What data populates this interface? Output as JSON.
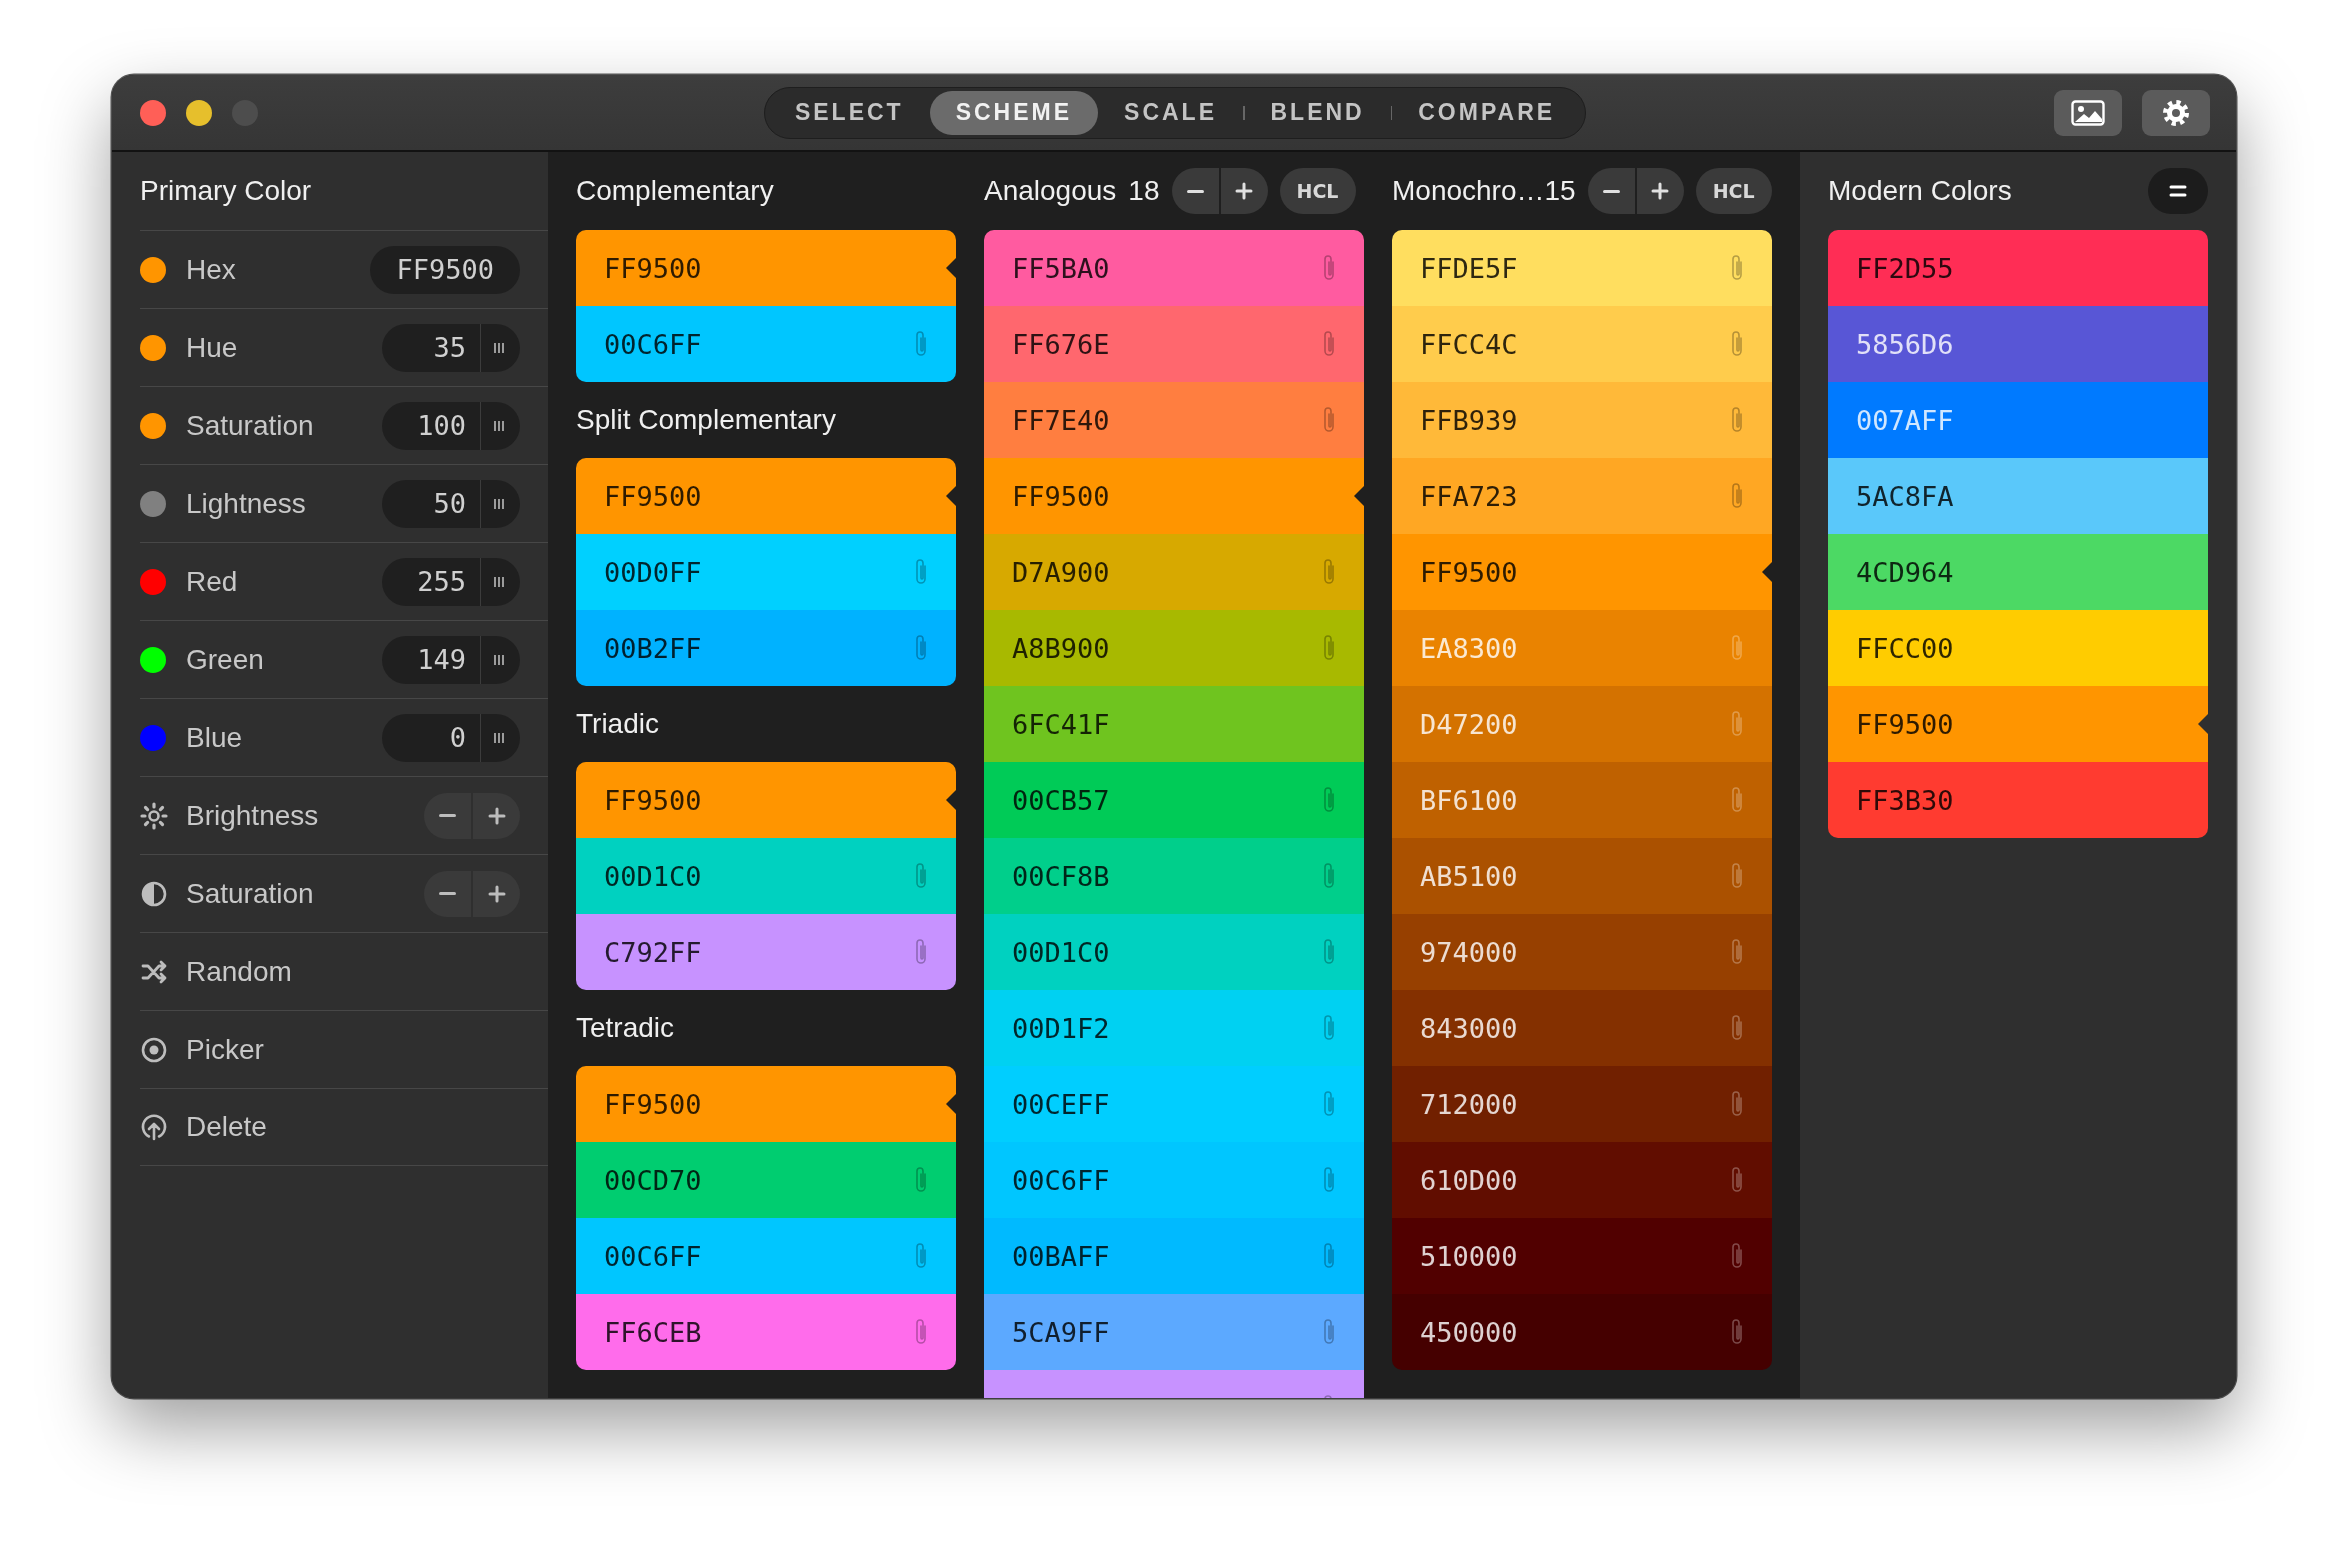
{
  "title_bar": {
    "traffic_lights": [
      {
        "color": "#ff5f57"
      },
      {
        "color": "#e6bf2c"
      },
      {
        "color": "#4d4d4d"
      }
    ],
    "tabs": [
      {
        "label": "SELECT",
        "selected": false
      },
      {
        "label": "SCHEME",
        "selected": true
      },
      {
        "label": "SCALE",
        "selected": false
      },
      {
        "label": "BLEND",
        "selected": false
      },
      {
        "label": "COMPARE",
        "selected": false
      }
    ]
  },
  "sidebar": {
    "title": "Primary Color",
    "rows": [
      {
        "kind": "hex",
        "label": "Hex",
        "color": "#ff9500",
        "value": "FF9500"
      },
      {
        "kind": "value",
        "label": "Hue",
        "color": "#ff9500",
        "value": "35"
      },
      {
        "kind": "value",
        "label": "Saturation",
        "color": "#ff9500",
        "value": "100"
      },
      {
        "kind": "value",
        "label": "Lightness",
        "color": "#808080",
        "value": "50"
      },
      {
        "kind": "value",
        "label": "Red",
        "color": "#ff0000",
        "value": "255"
      },
      {
        "kind": "value",
        "label": "Green",
        "color": "#00ff00",
        "value": "149"
      },
      {
        "kind": "value",
        "label": "Blue",
        "color": "#0000ff",
        "value": "0"
      },
      {
        "kind": "stepper",
        "label": "Brightness"
      },
      {
        "kind": "stepper",
        "label": "Saturation"
      },
      {
        "kind": "action",
        "label": "Random"
      },
      {
        "kind": "action",
        "label": "Picker"
      },
      {
        "kind": "action",
        "label": "Delete"
      }
    ]
  },
  "schemes": {
    "groups": [
      {
        "title": "Complementary",
        "swatches": [
          {
            "hex": "FF9500",
            "color": "#ff9500",
            "selected": true,
            "clip": false,
            "light_text": false
          },
          {
            "hex": "00C6FF",
            "color": "#00c6ff",
            "selected": false,
            "clip": true,
            "light_text": false
          }
        ]
      },
      {
        "title": "Split Complementary",
        "swatches": [
          {
            "hex": "FF9500",
            "color": "#ff9500",
            "selected": true,
            "clip": false,
            "light_text": false
          },
          {
            "hex": "00D0FF",
            "color": "#00d0ff",
            "selected": false,
            "clip": true,
            "light_text": false
          },
          {
            "hex": "00B2FF",
            "color": "#00b2ff",
            "selected": false,
            "clip": true,
            "light_text": false
          }
        ]
      },
      {
        "title": "Triadic",
        "swatches": [
          {
            "hex": "FF9500",
            "color": "#ff9500",
            "selected": true,
            "clip": false,
            "light_text": false
          },
          {
            "hex": "00D1C0",
            "color": "#00d1c0",
            "selected": false,
            "clip": true,
            "light_text": false
          },
          {
            "hex": "C792FF",
            "color": "#c792ff",
            "selected": false,
            "clip": true,
            "light_text": false
          }
        ]
      },
      {
        "title": "Tetradic",
        "swatches": [
          {
            "hex": "FF9500",
            "color": "#ff9500",
            "selected": true,
            "clip": false,
            "light_text": false
          },
          {
            "hex": "00CD70",
            "color": "#00cd70",
            "selected": false,
            "clip": true,
            "light_text": false
          },
          {
            "hex": "00C6FF",
            "color": "#00c6ff",
            "selected": false,
            "clip": true,
            "light_text": false
          },
          {
            "hex": "FF6CEB",
            "color": "#ff6ceb",
            "selected": false,
            "clip": true,
            "light_text": false
          }
        ]
      }
    ]
  },
  "analogous": {
    "title": "Analogous",
    "count": "18",
    "mode": "HCL",
    "swatches": [
      {
        "hex": "FF5BA0",
        "color": "#ff5ba0",
        "selected": false,
        "clip": true,
        "light_text": false
      },
      {
        "hex": "FF676E",
        "color": "#ff676e",
        "selected": false,
        "clip": true,
        "light_text": false
      },
      {
        "hex": "FF7E40",
        "color": "#ff7e40",
        "selected": false,
        "clip": true,
        "light_text": false
      },
      {
        "hex": "FF9500",
        "color": "#ff9500",
        "selected": true,
        "clip": false,
        "light_text": false
      },
      {
        "hex": "D7A900",
        "color": "#d7a900",
        "selected": false,
        "clip": true,
        "light_text": false
      },
      {
        "hex": "A8B900",
        "color": "#a8b900",
        "selected": false,
        "clip": true,
        "light_text": false
      },
      {
        "hex": "6FC41F",
        "color": "#6fc41f",
        "selected": false,
        "clip": false,
        "light_text": false
      },
      {
        "hex": "00CB57",
        "color": "#00cb57",
        "selected": false,
        "clip": true,
        "light_text": false
      },
      {
        "hex": "00CF8B",
        "color": "#00cf8b",
        "selected": false,
        "clip": true,
        "light_text": false
      },
      {
        "hex": "00D1C0",
        "color": "#00d1c0",
        "selected": false,
        "clip": true,
        "light_text": false
      },
      {
        "hex": "00D1F2",
        "color": "#00d1f2",
        "selected": false,
        "clip": true,
        "light_text": false
      },
      {
        "hex": "00CEFF",
        "color": "#00ceff",
        "selected": false,
        "clip": true,
        "light_text": false
      },
      {
        "hex": "00C6FF",
        "color": "#00c6ff",
        "selected": false,
        "clip": true,
        "light_text": false
      },
      {
        "hex": "00BAFF",
        "color": "#00baff",
        "selected": false,
        "clip": true,
        "light_text": false
      },
      {
        "hex": "5CA9FF",
        "color": "#5ca9ff",
        "selected": false,
        "clip": true,
        "light_text": false
      },
      {
        "color": "#c792ff",
        "clip": true,
        "light_text": false
      }
    ]
  },
  "monochromatic": {
    "title": "Monochro…",
    "count": "15",
    "mode": "HCL",
    "swatches": [
      {
        "hex": "FFDE5F",
        "color": "#ffde5f",
        "selected": false,
        "clip": true,
        "light_text": false
      },
      {
        "hex": "FFCC4C",
        "color": "#ffcc4c",
        "selected": false,
        "clip": true,
        "light_text": false
      },
      {
        "hex": "FFB939",
        "color": "#ffb939",
        "selected": false,
        "clip": true,
        "light_text": false
      },
      {
        "hex": "FFA723",
        "color": "#ffa723",
        "selected": false,
        "clip": true,
        "light_text": false
      },
      {
        "hex": "FF9500",
        "color": "#ff9500",
        "selected": true,
        "clip": false,
        "light_text": false
      },
      {
        "hex": "EA8300",
        "color": "#ea8300",
        "selected": false,
        "clip": true,
        "light_text": true
      },
      {
        "hex": "D47200",
        "color": "#d47200",
        "selected": false,
        "clip": true,
        "light_text": true
      },
      {
        "hex": "BF6100",
        "color": "#bf6100",
        "selected": false,
        "clip": true,
        "light_text": true
      },
      {
        "hex": "AB5100",
        "color": "#ab5100",
        "selected": false,
        "clip": true,
        "light_text": true
      },
      {
        "hex": "974000",
        "color": "#974000",
        "selected": false,
        "clip": true,
        "light_text": true
      },
      {
        "hex": "843000",
        "color": "#843000",
        "selected": false,
        "clip": true,
        "light_text": true
      },
      {
        "hex": "712000",
        "color": "#712000",
        "selected": false,
        "clip": true,
        "light_text": true
      },
      {
        "hex": "610D00",
        "color": "#610d00",
        "selected": false,
        "clip": true,
        "light_text": true
      },
      {
        "hex": "510000",
        "color": "#510000",
        "selected": false,
        "clip": true,
        "light_text": true
      },
      {
        "hex": "450000",
        "color": "#450000",
        "selected": false,
        "clip": true,
        "light_text": true
      }
    ]
  },
  "modern_colors": {
    "title": "Modern Colors",
    "swatches": [
      {
        "hex": "FF2D55",
        "color": "#ff2d55",
        "selected": false,
        "clip": false,
        "light_text": false
      },
      {
        "hex": "5856D6",
        "color": "#5856d6",
        "selected": false,
        "clip": false,
        "light_text": true
      },
      {
        "hex": "007AFF",
        "color": "#007aff",
        "selected": false,
        "clip": false,
        "light_text": true
      },
      {
        "hex": "5AC8FA",
        "color": "#5ac8fa",
        "selected": false,
        "clip": false,
        "light_text": false
      },
      {
        "hex": "4CD964",
        "color": "#4cd964",
        "selected": false,
        "clip": false,
        "light_text": false
      },
      {
        "hex": "FFCC00",
        "color": "#ffcc00",
        "selected": false,
        "clip": false,
        "light_text": false
      },
      {
        "hex": "FF9500",
        "color": "#ff9500",
        "selected": true,
        "clip": false,
        "light_text": false
      },
      {
        "hex": "FF3B30",
        "color": "#ff3b30",
        "selected": false,
        "clip": false,
        "light_text": false
      }
    ]
  }
}
